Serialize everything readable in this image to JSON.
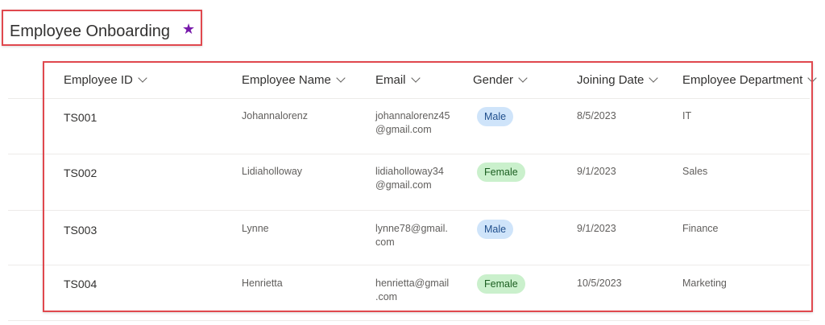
{
  "list": {
    "title": "Employee Onboarding",
    "favorite_icon": "star-icon",
    "accent_color": "#7719aa"
  },
  "columns": [
    {
      "label": "Employee ID"
    },
    {
      "label": "Employee Name"
    },
    {
      "label": "Email"
    },
    {
      "label": "Gender"
    },
    {
      "label": "Joining Date"
    },
    {
      "label": "Employee Department"
    }
  ],
  "rows": [
    {
      "id": "TS001",
      "name": "Johannalorenz",
      "email_line1": "johannalorenz45",
      "email_line2": "@gmail.com",
      "gender": "Male",
      "joining_date": "8/5/2023",
      "department": "IT"
    },
    {
      "id": "TS002",
      "name": "Lidiaholloway",
      "email_line1": "lidiaholloway34",
      "email_line2": "@gmail.com",
      "gender": "Female",
      "joining_date": "9/1/2023",
      "department": "Sales"
    },
    {
      "id": "TS003",
      "name": "Lynne",
      "email_line1": "lynne78@gmail.",
      "email_line2": "com",
      "gender": "Male",
      "joining_date": "9/1/2023",
      "department": "Finance"
    },
    {
      "id": "TS004",
      "name": "Henrietta",
      "email_line1": "henrietta@gmail",
      "email_line2": ".com",
      "gender": "Female",
      "joining_date": "10/5/2023",
      "department": "Marketing"
    }
  ],
  "colors": {
    "highlight_border": "#e0484e",
    "male_pill_bg": "#cfe4fa",
    "female_pill_bg": "#caf0cc"
  }
}
